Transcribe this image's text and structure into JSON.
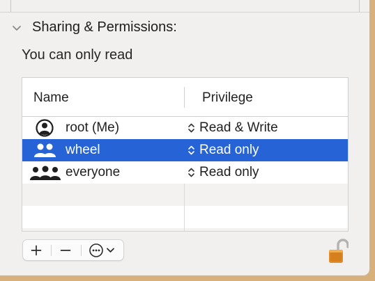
{
  "section": {
    "title": "Sharing & Permissions:"
  },
  "permission_text": "You can only read",
  "table": {
    "columns": [
      "Name",
      "Privilege"
    ],
    "rows": [
      {
        "icon": "single-user-icon",
        "name": "root (Me)",
        "privilege": "Read & Write",
        "selected": false
      },
      {
        "icon": "group-icon",
        "name": "wheel",
        "privilege": "Read only",
        "selected": true
      },
      {
        "icon": "everyone-icon",
        "name": "everyone",
        "privilege": "Read only",
        "selected": false
      }
    ]
  },
  "toolbar": {
    "add": "+",
    "remove": "−"
  },
  "colors": {
    "selection": "#2663d6",
    "lock": "#e0912d",
    "background": "#d8b07c"
  }
}
